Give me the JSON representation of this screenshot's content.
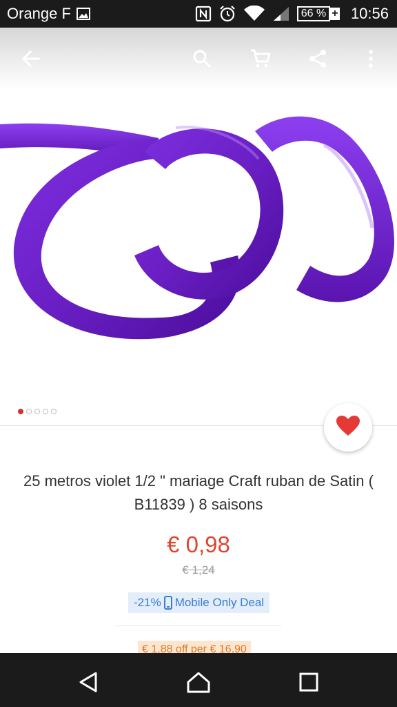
{
  "status_bar": {
    "carrier": "Orange F",
    "battery": "66 %",
    "battery_plus": "+",
    "time": "10:56",
    "icons": [
      "image-icon",
      "nfc-icon",
      "alarm-icon",
      "wifi-icon",
      "signal-icon",
      "battery-icon"
    ]
  },
  "app_bar": {
    "icons": [
      "back-arrow-icon",
      "search-icon",
      "cart-icon",
      "share-icon",
      "more-vert-icon"
    ]
  },
  "carousel": {
    "image": "purple satin ribbon",
    "total": 5,
    "active": 1
  },
  "product": {
    "title": "25 metros violet 1/2 \" mariage Craft ruban de Satin ( B11839 ) 8 saisons",
    "price": "€ 0,98",
    "old_price": "€ 1,24",
    "discount": "-21%",
    "deal_label": "Mobile Only Deal",
    "coupon": "€ 1,88 off per € 16,90"
  },
  "colors": {
    "accent": "#e0452f",
    "favorite": "#e53935",
    "deal_blue": "#3a7bd5",
    "coupon_orange": "#e07a2a",
    "ribbon_purple": "#6a1fc4"
  },
  "nav_bar": {
    "icons": [
      "back-triangle-icon",
      "home-icon",
      "recents-icon"
    ]
  }
}
